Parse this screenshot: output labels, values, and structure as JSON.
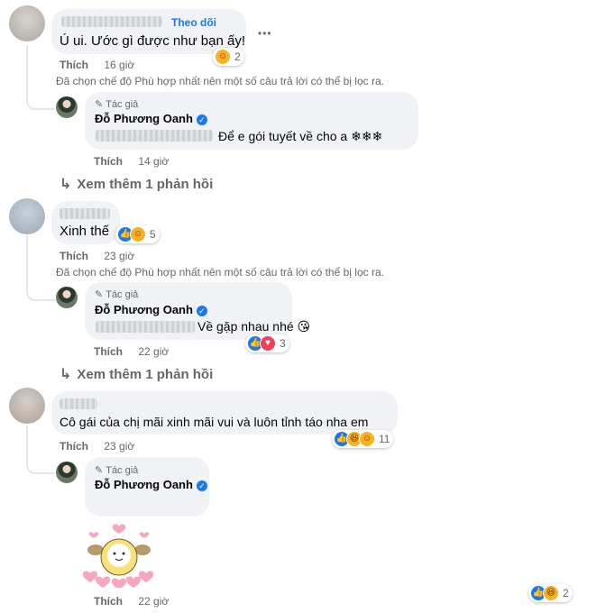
{
  "follow_label": "Theo dõi",
  "more_options_label": "•••",
  "like_label": "Thích",
  "filter_notice": "Đã chọn chế độ Phù hợp nhất nên một số câu trả lời có thể bị lọc ra.",
  "author_badge": "Tác giả",
  "author_name": "Đỗ Phương Oanh",
  "see_more_replies": "Xem thêm 1 phản hồi",
  "comments": [
    {
      "text": "Ú ui. Ước gì được như bạn ấy!",
      "time": "16 giờ",
      "reaction_count": "2",
      "reactions": [
        "care-icon"
      ]
    },
    {
      "text": "Xinh thế",
      "time": "23 giờ",
      "reaction_count": "5",
      "reactions": [
        "like-icon",
        "care-icon"
      ]
    },
    {
      "text": "Cô gái của chị mãi xinh mãi vui và luôn tỉnh táo nha em",
      "time": "23 giờ",
      "reaction_count": "11",
      "reactions": [
        "like-icon",
        "haha-icon",
        "care-icon"
      ]
    }
  ],
  "replies": [
    {
      "text": "Để e gói tuyết về cho a ❄❄❄",
      "time": "14 giờ"
    },
    {
      "text": "Về gặp nhau nhé 😘",
      "time": "22 giờ",
      "reaction_count": "3",
      "reactions": [
        "like-icon",
        "love-icon"
      ]
    },
    {
      "sticker": "cute-sticker",
      "time": "22 giờ",
      "reaction_count": "2",
      "reactions": [
        "like-icon",
        "haha-icon"
      ]
    }
  ],
  "colors": {
    "accent": "#1877f2",
    "bubble": "#f0f2f5",
    "muted": "#65676b"
  }
}
